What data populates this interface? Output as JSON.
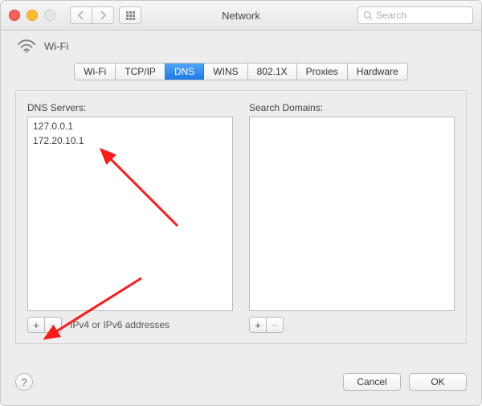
{
  "window": {
    "title": "Network"
  },
  "search": {
    "placeholder": "Search"
  },
  "header": {
    "connection_name": "Wi-Fi"
  },
  "tabs": [
    {
      "label": "Wi-Fi"
    },
    {
      "label": "TCP/IP"
    },
    {
      "label": "DNS"
    },
    {
      "label": "WINS"
    },
    {
      "label": "802.1X"
    },
    {
      "label": "Proxies"
    },
    {
      "label": "Hardware"
    }
  ],
  "active_tab_index": 2,
  "dns_panel": {
    "servers_label": "DNS Servers:",
    "servers": [
      "127.0.0.1",
      "172.20.10.1"
    ],
    "hint": "IPv4 or IPv6 addresses",
    "search_domains_label": "Search Domains:",
    "search_domains": []
  },
  "glyphs": {
    "plus": "+",
    "minus": "−",
    "help": "?"
  },
  "buttons": {
    "cancel": "Cancel",
    "ok": "OK"
  },
  "colors": {
    "accent": "#2d85ef",
    "arrow": "#ff1a1a"
  }
}
